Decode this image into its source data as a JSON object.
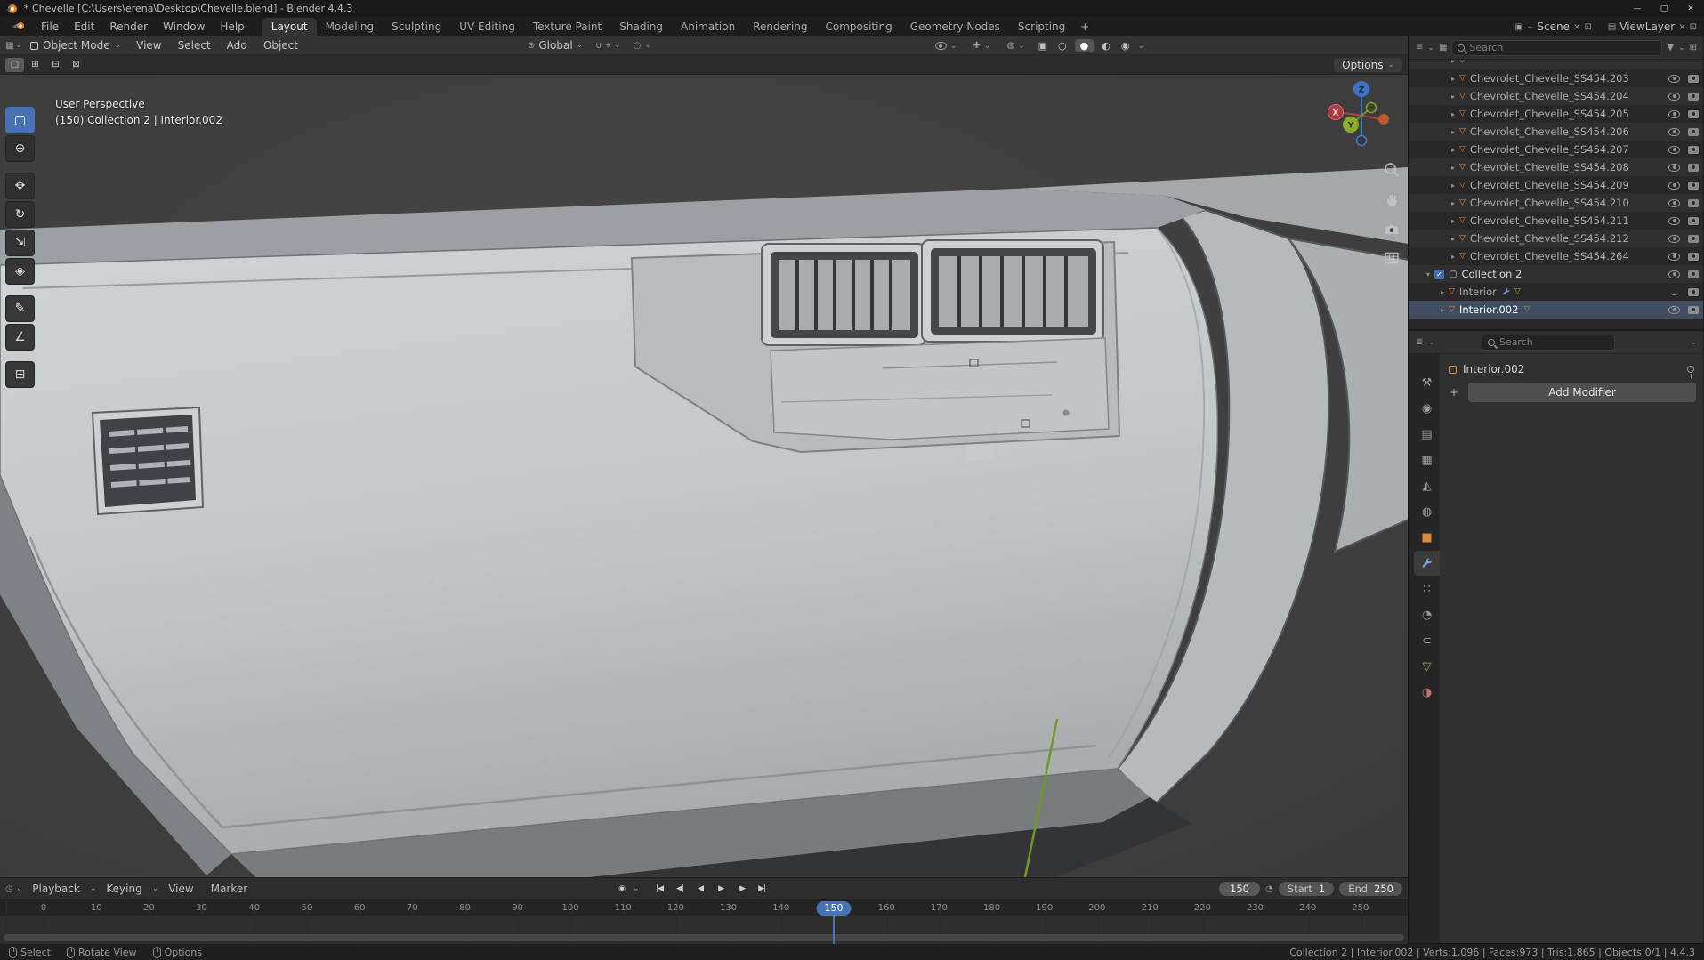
{
  "colors": {
    "accent": "#4772b3",
    "object_orange": "#d98b3c",
    "data_green": "#7fb34e"
  },
  "titlebar": {
    "title": "* Chevelle [C:\\Users\\erena\\Desktop\\Chevelle.blend] - Blender 4.4.3",
    "minimize": "—",
    "maximize": "▢",
    "close": "✕"
  },
  "menubar": {
    "menus": [
      "File",
      "Edit",
      "Render",
      "Window",
      "Help"
    ],
    "workspaces": [
      "Layout",
      "Modeling",
      "Sculpting",
      "UV Editing",
      "Texture Paint",
      "Shading",
      "Animation",
      "Rendering",
      "Compositing",
      "Geometry Nodes",
      "Scripting"
    ],
    "add_workspace": "+",
    "scene_label": "Scene",
    "viewlayer_label": "ViewLayer"
  },
  "viewport": {
    "header": {
      "mode": "Object Mode",
      "menus": [
        "View",
        "Select",
        "Add",
        "Object"
      ],
      "orientation": "Global"
    },
    "tool_settings": {
      "options_label": "Options"
    },
    "overlay": {
      "perspective": "User Perspective",
      "context": "(150) Collection 2 | Interior.002"
    },
    "gizmo": {
      "x": "X",
      "y": "Y",
      "z": "Z"
    }
  },
  "toolbar": {
    "tools": [
      {
        "name": "select-box",
        "glyph": "▢"
      },
      {
        "name": "cursor",
        "glyph": "⊕"
      },
      {
        "name": "move",
        "glyph": "✥"
      },
      {
        "name": "rotate",
        "glyph": "↻"
      },
      {
        "name": "scale",
        "glyph": "⇲"
      },
      {
        "name": "transform",
        "glyph": "◈"
      },
      {
        "name": "annotate",
        "glyph": "✎"
      },
      {
        "name": "measure",
        "glyph": "∠"
      },
      {
        "name": "add-cube",
        "glyph": "⊞"
      }
    ]
  },
  "outliner": {
    "search_placeholder": "Search",
    "items": [
      "Chevrolet_Chevelle_SS454.203",
      "Chevrolet_Chevelle_SS454.204",
      "Chevrolet_Chevelle_SS454.205",
      "Chevrolet_Chevelle_SS454.206",
      "Chevrolet_Chevelle_SS454.207",
      "Chevrolet_Chevelle_SS454.208",
      "Chevrolet_Chevelle_SS454.209",
      "Chevrolet_Chevelle_SS454.210",
      "Chevrolet_Chevelle_SS454.211",
      "Chevrolet_Chevelle_SS454.212",
      "Chevrolet_Chevelle_SS454.264"
    ],
    "collection": "Collection 2",
    "interior": "Interior",
    "interior002": "Interior.002"
  },
  "properties": {
    "search_placeholder": "Search",
    "breadcrumb": "Interior.002",
    "add_modifier": "Add Modifier",
    "tabs": [
      {
        "name": "tool",
        "glyph": "⚒"
      },
      {
        "name": "render",
        "glyph": "◉"
      },
      {
        "name": "output",
        "glyph": "▤"
      },
      {
        "name": "view-layer",
        "glyph": "▦"
      },
      {
        "name": "scene",
        "glyph": "◭"
      },
      {
        "name": "world",
        "glyph": "◍"
      },
      {
        "name": "object",
        "glyph": "■"
      },
      {
        "name": "modifiers",
        "glyph": ""
      },
      {
        "name": "particles",
        "glyph": "∷"
      },
      {
        "name": "physics",
        "glyph": "◔"
      },
      {
        "name": "constraints",
        "glyph": "⊂"
      },
      {
        "name": "object-data",
        "glyph": "▽"
      },
      {
        "name": "material",
        "glyph": "◑"
      }
    ]
  },
  "timeline": {
    "menus": [
      "Playback",
      "Keying",
      "View",
      "Marker"
    ],
    "autokey_glyph": "◉",
    "transport": [
      "|◀",
      "◀|",
      "◀",
      "▶",
      "|▶",
      "▶|"
    ],
    "frame_field": "150",
    "current_frame": "150",
    "stopwatch_glyph": "◔",
    "start_label": "Start",
    "start_value": "1",
    "end_label": "End",
    "end_value": "250",
    "ticks": [
      "0",
      "10",
      "20",
      "30",
      "40",
      "50",
      "60",
      "70",
      "80",
      "90",
      "100",
      "110",
      "120",
      "130",
      "140",
      "150",
      "160",
      "170",
      "180",
      "190",
      "200",
      "210",
      "220",
      "230",
      "240",
      "250"
    ]
  },
  "statusbar": {
    "hints": [
      "Select",
      "Rotate View",
      "Options"
    ],
    "info": "Collection 2 | Interior.002 | Verts:1,096 | Faces:973 | Tris:1,865 | Objects:0/1 | 4.4.3"
  },
  "glyphs": {
    "caret": "⌄",
    "caret_small": "▾",
    "expand": "▸",
    "collapse": "▾",
    "check": "✓",
    "mesh": "▽",
    "collection": "▢",
    "data": "▽",
    "editor_viewport": "▦",
    "editor_outliner": "≡",
    "editor_props": "≣",
    "editor_timeline": "◷",
    "orientation": "⊕",
    "magnet": "∪",
    "snap": "⌖",
    "proportional": "○",
    "gizmo_btn": "✚",
    "overlays": "◍",
    "xray": "▣",
    "shade_wire": "○",
    "shade_solid": "●",
    "shade_material": "◐",
    "shade_render": "◉",
    "filter": "▼",
    "new_collection": "⊞",
    "display_mode": "▦",
    "scene_icon": "▣",
    "viewlayer_icon": "▤",
    "x_small": "×",
    "copy_small": "⊡",
    "sel_new": "▢",
    "sel_add": "⊞",
    "sel_sub": "⊟",
    "sel_inv": "⊠",
    "plus": "+"
  }
}
